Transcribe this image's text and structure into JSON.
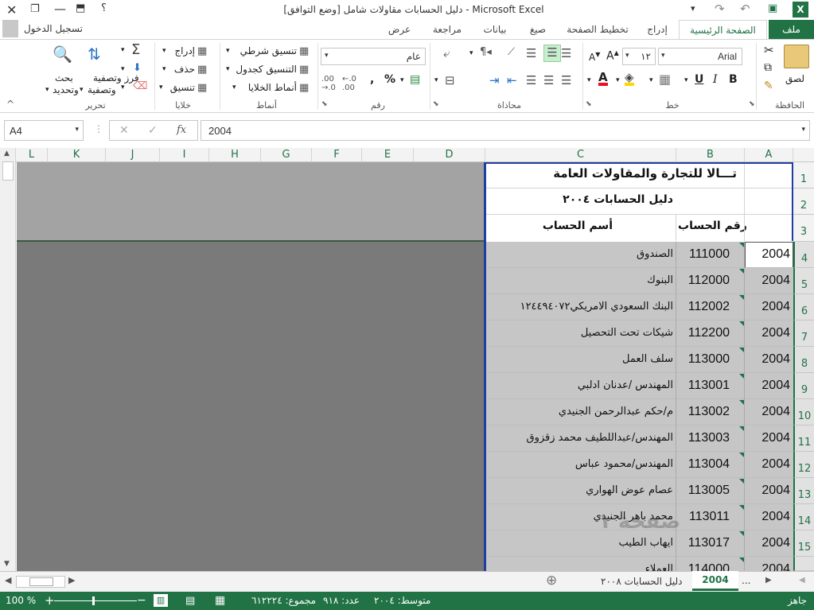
{
  "window": {
    "title": "دليل الحسابات مقاولات شامل  [وضع التوافق] - Microsoft Excel",
    "help": "؟"
  },
  "account": {
    "signin": "تسجيل الدخول"
  },
  "tabs": [
    "ملف",
    "الصفحة الرئيسية",
    "إدراج",
    "تخطيط الصفحة",
    "صيغ",
    "بيانات",
    "مراجعة",
    "عرض"
  ],
  "ribbon": {
    "clipboard": {
      "label": "الحافظة",
      "paste": "لصق"
    },
    "font": {
      "label": "خط",
      "name": "Arial",
      "size": "١٢"
    },
    "alignment": {
      "label": "محاذاة"
    },
    "number": {
      "label": "رقم",
      "format": "عام"
    },
    "styles": {
      "label": "أنماط",
      "conditional": "تنسيق شرطي",
      "table": "التنسيق كجدول",
      "cell": "أنماط الخلايا"
    },
    "cells": {
      "label": "خلايا",
      "insert": "إدراج",
      "delete": "حذف",
      "format": "تنسيق"
    },
    "editing": {
      "label": "تحرير",
      "sort": "فرز وتصفية",
      "sort2": "وتصفية",
      "find": "بحث",
      "find2": "وتحديد"
    }
  },
  "formula": {
    "namebox": "A4",
    "fx": "fx",
    "value": "2004"
  },
  "columns": [
    "A",
    "B",
    "C",
    "D",
    "E",
    "F",
    "G",
    "H",
    "I",
    "J",
    "K",
    "L"
  ],
  "header": {
    "company": "تـــالا للتجارة والمقاولات العامة",
    "subtitle": "دليل الحسابات ٢٠٠٤",
    "col_acct_no": "رقم الحساب",
    "col_acct_name": "أسم الحساب"
  },
  "rows": [
    {
      "n": "1"
    },
    {
      "n": "2"
    },
    {
      "n": "3"
    },
    {
      "n": "4",
      "a": "2004",
      "b": "111000",
      "c": "الصندوق"
    },
    {
      "n": "5",
      "a": "2004",
      "b": "112000",
      "c": "البنوك"
    },
    {
      "n": "6",
      "a": "2004",
      "b": "112002",
      "c": "البنك السعودي الامريكي١٢٤٤٩٤٠٧٢"
    },
    {
      "n": "7",
      "a": "2004",
      "b": "112200",
      "c": "شيكات تحت التحصيل"
    },
    {
      "n": "8",
      "a": "2004",
      "b": "113000",
      "c": "سلف العمل"
    },
    {
      "n": "9",
      "a": "2004",
      "b": "113001",
      "c": "المهندس /عدنان ادلبي"
    },
    {
      "n": "10",
      "a": "2004",
      "b": "113002",
      "c": "م/حكم عبدالرحمن الجنيدي"
    },
    {
      "n": "11",
      "a": "2004",
      "b": "113003",
      "c": "المهندس/عبداللطيف محمد زقزوق"
    },
    {
      "n": "12",
      "a": "2004",
      "b": "113004",
      "c": "المهندس/محمود عباس"
    },
    {
      "n": "13",
      "a": "2004",
      "b": "113005",
      "c": "عصام عوض الهواري"
    },
    {
      "n": "14",
      "a": "2004",
      "b": "113011",
      "c": "محمد باهر الجنيدي"
    },
    {
      "n": "15",
      "a": "2004",
      "b": "113017",
      "c": "ايهاب الطيب"
    },
    {
      "n": "",
      "a": "2004",
      "b": "114000",
      "c": "العملاء"
    }
  ],
  "watermark": "صفحة ١",
  "sheets": {
    "active": "2004",
    "other": "دليل الحسابات ٢٠٠٨",
    "more": "..."
  },
  "statusbar": {
    "ready": "جاهز",
    "average": "متوسط: ٢٠٠٤",
    "count": "عدد: ٩١٨",
    "sum": "مجموع: ٦١٢٢٢٤",
    "zoom": "100 %"
  },
  "colors": {
    "accent": "#217346",
    "selection": "#c6c6c6"
  }
}
